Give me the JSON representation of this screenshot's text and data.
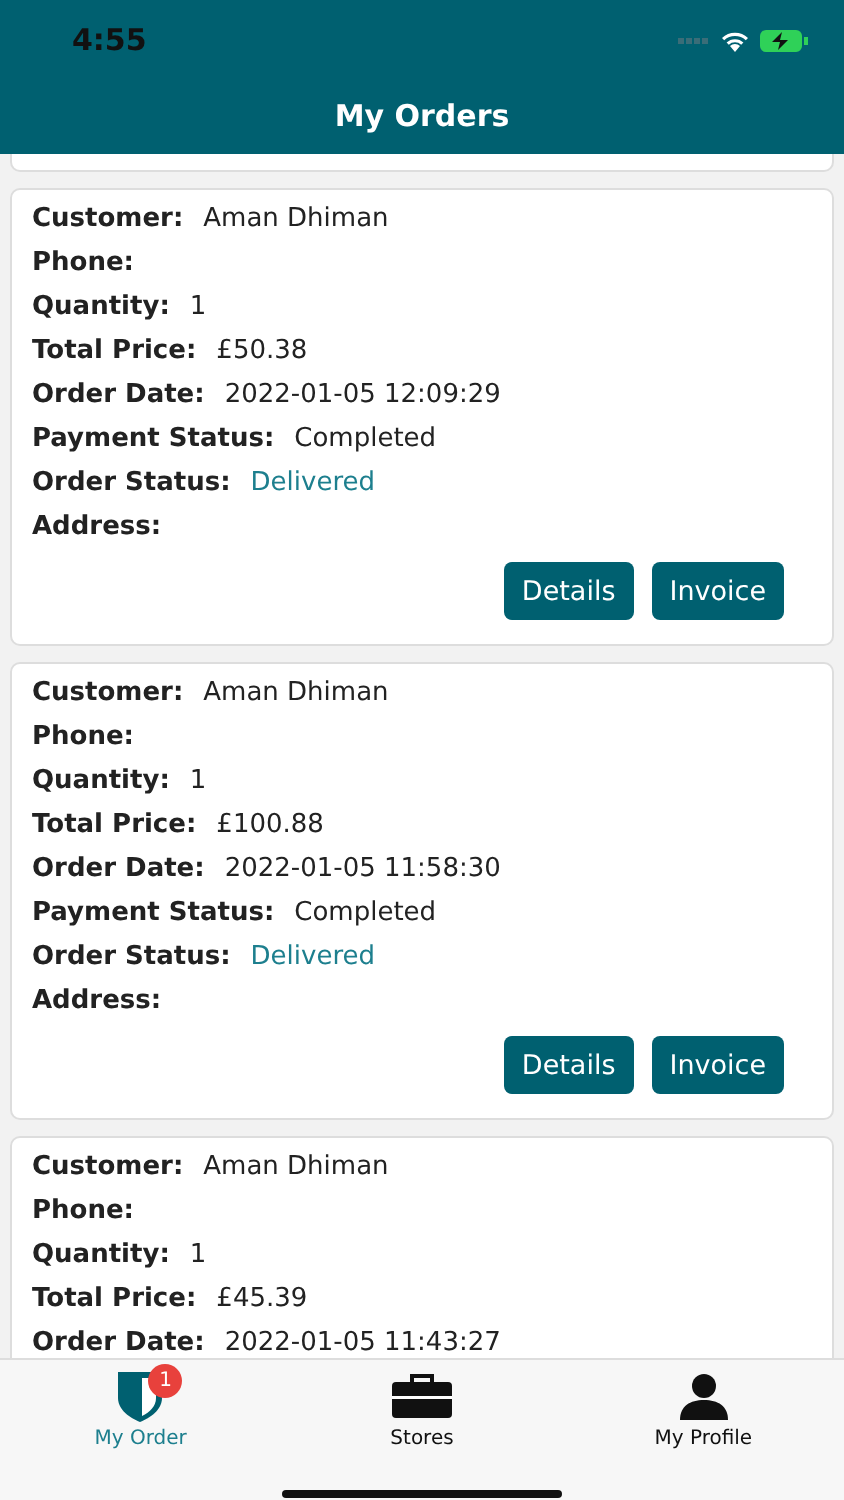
{
  "status_bar": {
    "time": "4:55"
  },
  "header": {
    "title": "My Orders"
  },
  "orders": [
    {
      "fields": [
        {
          "kind": "text",
          "label": "Customer:",
          "value": "Aman Dhiman"
        },
        {
          "kind": "text",
          "label": "Phone:"
        },
        {
          "kind": "text",
          "label": "Quantity:",
          "value": "1"
        },
        {
          "kind": "text",
          "label": "Total Price:",
          "value": "£50.38"
        },
        {
          "kind": "text",
          "label": "Order Date:",
          "value": "2022-01-05 12:09:29"
        },
        {
          "kind": "text",
          "label": "Payment Status:",
          "value": "Completed"
        },
        {
          "kind": "status",
          "label": "Order Status:",
          "value": "Delivered"
        },
        {
          "kind": "text",
          "label": "Address:"
        }
      ],
      "buttons": [
        "Details",
        "Invoice"
      ]
    },
    {
      "fields": [
        {
          "kind": "text",
          "label": "Customer:",
          "value": "Aman Dhiman"
        },
        {
          "kind": "text",
          "label": "Phone:"
        },
        {
          "kind": "text",
          "label": "Quantity:",
          "value": "1"
        },
        {
          "kind": "text",
          "label": "Total Price:",
          "value": "£100.88"
        },
        {
          "kind": "text",
          "label": "Order Date:",
          "value": "2022-01-05 11:58:30"
        },
        {
          "kind": "text",
          "label": "Payment Status:",
          "value": "Completed"
        },
        {
          "kind": "status",
          "label": "Order Status:",
          "value": "Delivered"
        },
        {
          "kind": "text",
          "label": "Address:"
        }
      ],
      "buttons": [
        "Details",
        "Invoice"
      ]
    },
    {
      "fields": [
        {
          "kind": "text",
          "label": "Customer:",
          "value": "Aman Dhiman"
        },
        {
          "kind": "text",
          "label": "Phone:"
        },
        {
          "kind": "text",
          "label": "Quantity:",
          "value": "1"
        },
        {
          "kind": "text",
          "label": "Total Price:",
          "value": "£45.39"
        },
        {
          "kind": "text",
          "label": "Order Date:",
          "value": "2022-01-05 11:43:27"
        }
      ]
    }
  ],
  "tab_bar": [
    {
      "kind": "orders",
      "label": "My Order",
      "selected": true,
      "badge": "1"
    },
    {
      "kind": "stores",
      "label": "Stores",
      "selected": false
    },
    {
      "kind": "profile",
      "label": "My Profile",
      "selected": false
    }
  ]
}
